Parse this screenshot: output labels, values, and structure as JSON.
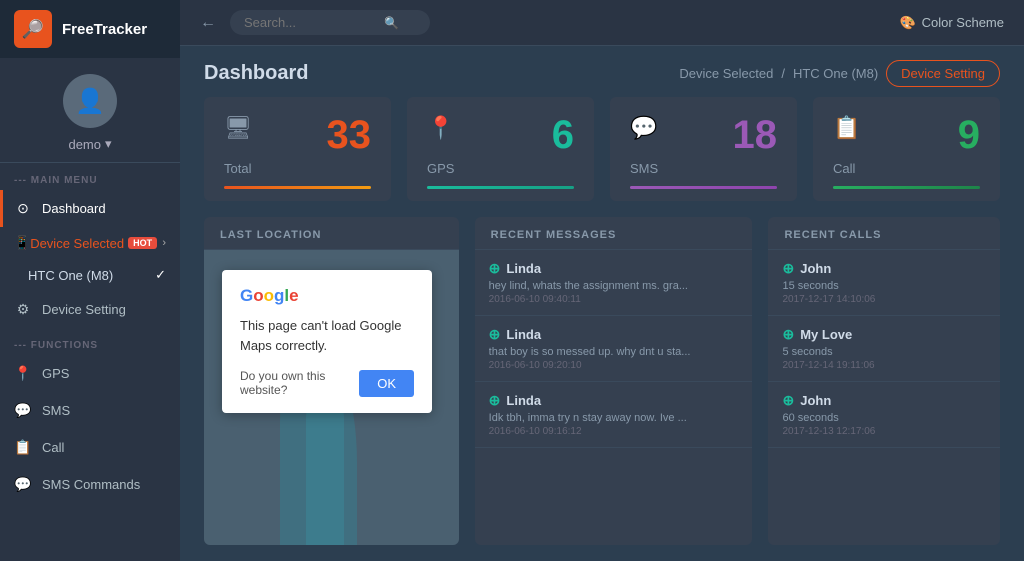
{
  "app": {
    "name": "FreeTracker"
  },
  "sidebar": {
    "user": "demo",
    "sections": [
      {
        "label": "--- MAIN MENU",
        "items": [
          {
            "id": "dashboard",
            "label": "Dashboard",
            "icon": "⊙",
            "active": true
          },
          {
            "id": "device-selected",
            "label": "Device Selected",
            "badge": "HOT",
            "icon": "📱"
          },
          {
            "id": "htc-one",
            "label": "HTC One (M8)",
            "check": true
          },
          {
            "id": "device-setting",
            "label": "Device Setting",
            "icon": "⚙"
          }
        ]
      },
      {
        "label": "--- FUNCTIONS",
        "items": [
          {
            "id": "gps",
            "label": "GPS",
            "icon": "📍"
          },
          {
            "id": "sms",
            "label": "SMS",
            "icon": "💬"
          },
          {
            "id": "call",
            "label": "Call",
            "icon": "📋"
          },
          {
            "id": "sms-commands",
            "label": "SMS Commands",
            "icon": "💬"
          }
        ]
      }
    ]
  },
  "topbar": {
    "search_placeholder": "Search...",
    "color_scheme": "Color Scheme"
  },
  "header": {
    "title": "Dashboard",
    "breadcrumb_device": "Device Selected",
    "breadcrumb_sep": "/",
    "breadcrumb_model": "HTC One (M8)",
    "device_setting_btn": "Device Setting"
  },
  "stats": [
    {
      "id": "total",
      "label": "Total",
      "value": "33",
      "icon": "🖥"
    },
    {
      "id": "gps",
      "label": "GPS",
      "value": "6",
      "icon": "📍"
    },
    {
      "id": "sms",
      "label": "SMS",
      "value": "18",
      "icon": "💬"
    },
    {
      "id": "call",
      "label": "Call",
      "value": "9",
      "icon": "📋"
    }
  ],
  "panels": {
    "location": {
      "title": "LAST LOCATION"
    },
    "map_dialog": {
      "google_logo": "Google",
      "message": "This page can't load Google Maps correctly.",
      "question": "Do you own this website?",
      "ok_btn": "OK"
    },
    "messages": {
      "title": "RECENT MESSAGES",
      "items": [
        {
          "sender": "Linda",
          "text": "hey lind, whats the assignment ms. gra...",
          "time": "2016-06-10 09:40:11"
        },
        {
          "sender": "Linda",
          "text": "that boy is so messed up. why dnt u sta...",
          "time": "2016-06-10 09:20:10"
        },
        {
          "sender": "Linda",
          "text": "Idk tbh, imma try n stay away now. Ive ...",
          "time": "2016-06-10 09:16:12"
        }
      ]
    },
    "calls": {
      "title": "RECENT CALLS",
      "items": [
        {
          "name": "John",
          "duration": "15 seconds",
          "time": "2017-12-17 14:10:06"
        },
        {
          "name": "My Love",
          "duration": "5 seconds",
          "time": "2017-12-14 19:11:06"
        },
        {
          "name": "John",
          "duration": "60 seconds",
          "time": "2017-12-13 12:17:06"
        }
      ]
    }
  }
}
